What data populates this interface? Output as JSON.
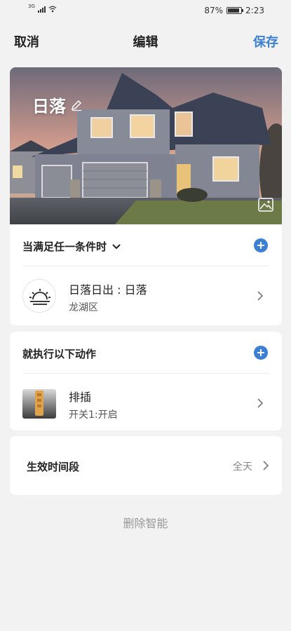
{
  "status_bar": {
    "network": "3G",
    "battery": "87%",
    "battery_level": 0.87,
    "time": "2:23"
  },
  "header": {
    "cancel": "取消",
    "title": "编辑",
    "save": "保存"
  },
  "scene": {
    "name": "日落"
  },
  "conditions": {
    "title": "当满足任一条件时",
    "item": {
      "title": "日落日出 : 日落",
      "subtitle": "龙湖区",
      "icon": "sunset-icon"
    }
  },
  "actions": {
    "title": "就执行以下动作",
    "item": {
      "title": "排插",
      "subtitle": "开关1:开启",
      "icon": "power-strip-icon"
    }
  },
  "period": {
    "label": "生效时间段",
    "value": "全天"
  },
  "delete": "删除智能",
  "colors": {
    "accent": "#3b7fd6",
    "background": "#f2f2f2"
  }
}
